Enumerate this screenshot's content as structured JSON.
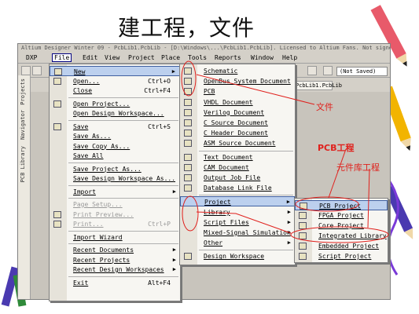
{
  "slide": {
    "title": "建工程，文件"
  },
  "app": {
    "titlebar": "Altium Designer Winter 09 - PcbLib1.PcbLib - [D:\\Windows\\...\\PcbLib1.PcbLib]. Licensed to Altium Fans. Not signed in.",
    "doc_tab": "PcbLib1.PcbLib",
    "not_saved": "(Not Saved)",
    "side_tabs": [
      "Projects",
      "Navigator",
      "PCB Library"
    ]
  },
  "menubar": [
    {
      "label": "DXP"
    },
    {
      "label": "File"
    },
    {
      "label": "Edit"
    },
    {
      "label": "View"
    },
    {
      "label": "Project"
    },
    {
      "label": "Place"
    },
    {
      "label": "Tools"
    },
    {
      "label": "Reports"
    },
    {
      "label": "Window"
    },
    {
      "label": "Help"
    }
  ],
  "file_menu": [
    {
      "label": "New",
      "shortcut": "",
      "submenu": true,
      "highlighted": true,
      "icon": "new-icon"
    },
    {
      "label": "Open...",
      "shortcut": "Ctrl+O",
      "icon": "open-icon"
    },
    {
      "label": "Close",
      "shortcut": "Ctrl+F4",
      "icon": ""
    },
    {
      "sep": true
    },
    {
      "label": "Open Project...",
      "shortcut": "",
      "icon": "open-project-icon"
    },
    {
      "label": "Open Design Workspace...",
      "shortcut": "",
      "icon": ""
    },
    {
      "sep": true
    },
    {
      "label": "Save",
      "shortcut": "Ctrl+S",
      "icon": "save-icon"
    },
    {
      "label": "Save As...",
      "shortcut": "",
      "icon": ""
    },
    {
      "label": "Save Copy As...",
      "shortcut": "",
      "icon": ""
    },
    {
      "label": "Save All",
      "shortcut": "",
      "icon": ""
    },
    {
      "sep": true
    },
    {
      "label": "Save Project As...",
      "shortcut": "",
      "icon": ""
    },
    {
      "label": "Save Design Workspace As...",
      "shortcut": "",
      "icon": ""
    },
    {
      "sep": true
    },
    {
      "label": "Import",
      "shortcut": "",
      "submenu": true,
      "icon": ""
    },
    {
      "sep": true
    },
    {
      "label": "Page Setup...",
      "shortcut": "",
      "disabled": true,
      "icon": ""
    },
    {
      "label": "Print Preview...",
      "shortcut": "",
      "disabled": true,
      "icon": "print-preview-icon"
    },
    {
      "label": "Print...",
      "shortcut": "Ctrl+P",
      "disabled": true,
      "icon": "print-icon"
    },
    {
      "sep": true
    },
    {
      "label": "Import Wizard",
      "shortcut": "",
      "icon": ""
    },
    {
      "sep": true
    },
    {
      "label": "Recent Documents",
      "shortcut": "",
      "submenu": true,
      "icon": ""
    },
    {
      "label": "Recent Projects",
      "shortcut": "",
      "submenu": true,
      "icon": ""
    },
    {
      "label": "Recent Design Workspaces",
      "shortcut": "",
      "submenu": true,
      "icon": ""
    },
    {
      "sep": true
    },
    {
      "label": "Exit",
      "shortcut": "Alt+F4",
      "icon": ""
    }
  ],
  "new_menu": [
    {
      "label": "Schematic",
      "icon": "schematic-icon"
    },
    {
      "label": "OpenBus System Document",
      "icon": "openbus-icon"
    },
    {
      "label": "PCB",
      "icon": "pcb-icon"
    },
    {
      "label": "VHDL Document",
      "icon": "vhdl-icon"
    },
    {
      "label": "Verilog Document",
      "icon": "verilog-icon"
    },
    {
      "label": "C Source Document",
      "icon": "c-source-icon"
    },
    {
      "label": "C Header Document",
      "icon": "c-header-icon"
    },
    {
      "label": "ASM Source Document",
      "icon": "asm-icon"
    },
    {
      "sep": true
    },
    {
      "label": "Text Document",
      "icon": "text-doc-icon"
    },
    {
      "label": "CAM Document",
      "icon": "cam-icon"
    },
    {
      "label": "Output Job File",
      "icon": "output-job-icon"
    },
    {
      "label": "Database Link File",
      "icon": "database-link-icon"
    },
    {
      "sep": true
    },
    {
      "label": "Project",
      "submenu": true,
      "highlighted": true,
      "icon": ""
    },
    {
      "label": "Library",
      "submenu": true,
      "icon": ""
    },
    {
      "label": "Script Files",
      "submenu": true,
      "icon": ""
    },
    {
      "label": "Mixed-Signal Simulation",
      "submenu": true,
      "icon": ""
    },
    {
      "label": "Other",
      "submenu": true,
      "icon": ""
    },
    {
      "sep": true
    },
    {
      "label": "Design Workspace",
      "icon": "workspace-icon"
    }
  ],
  "project_menu": [
    {
      "label": "PCB Project",
      "highlighted": true,
      "icon": "pcb-project-icon"
    },
    {
      "label": "FPGA Project",
      "icon": "fpga-project-icon"
    },
    {
      "label": "Core Project",
      "icon": "core-project-icon"
    },
    {
      "label": "Integrated Library",
      "icon": "integrated-library-icon"
    },
    {
      "label": "Embedded Project",
      "icon": "embedded-project-icon"
    },
    {
      "label": "Script Project",
      "icon": "script-project-icon"
    }
  ],
  "annotations": {
    "file": "文件",
    "pcb_project": "PCB工程",
    "library_project": "元件库工程"
  },
  "colors": {
    "annotation": "#e0201c",
    "highlight": "#bcd0ee",
    "menu_bg": "#f7f6f2"
  }
}
